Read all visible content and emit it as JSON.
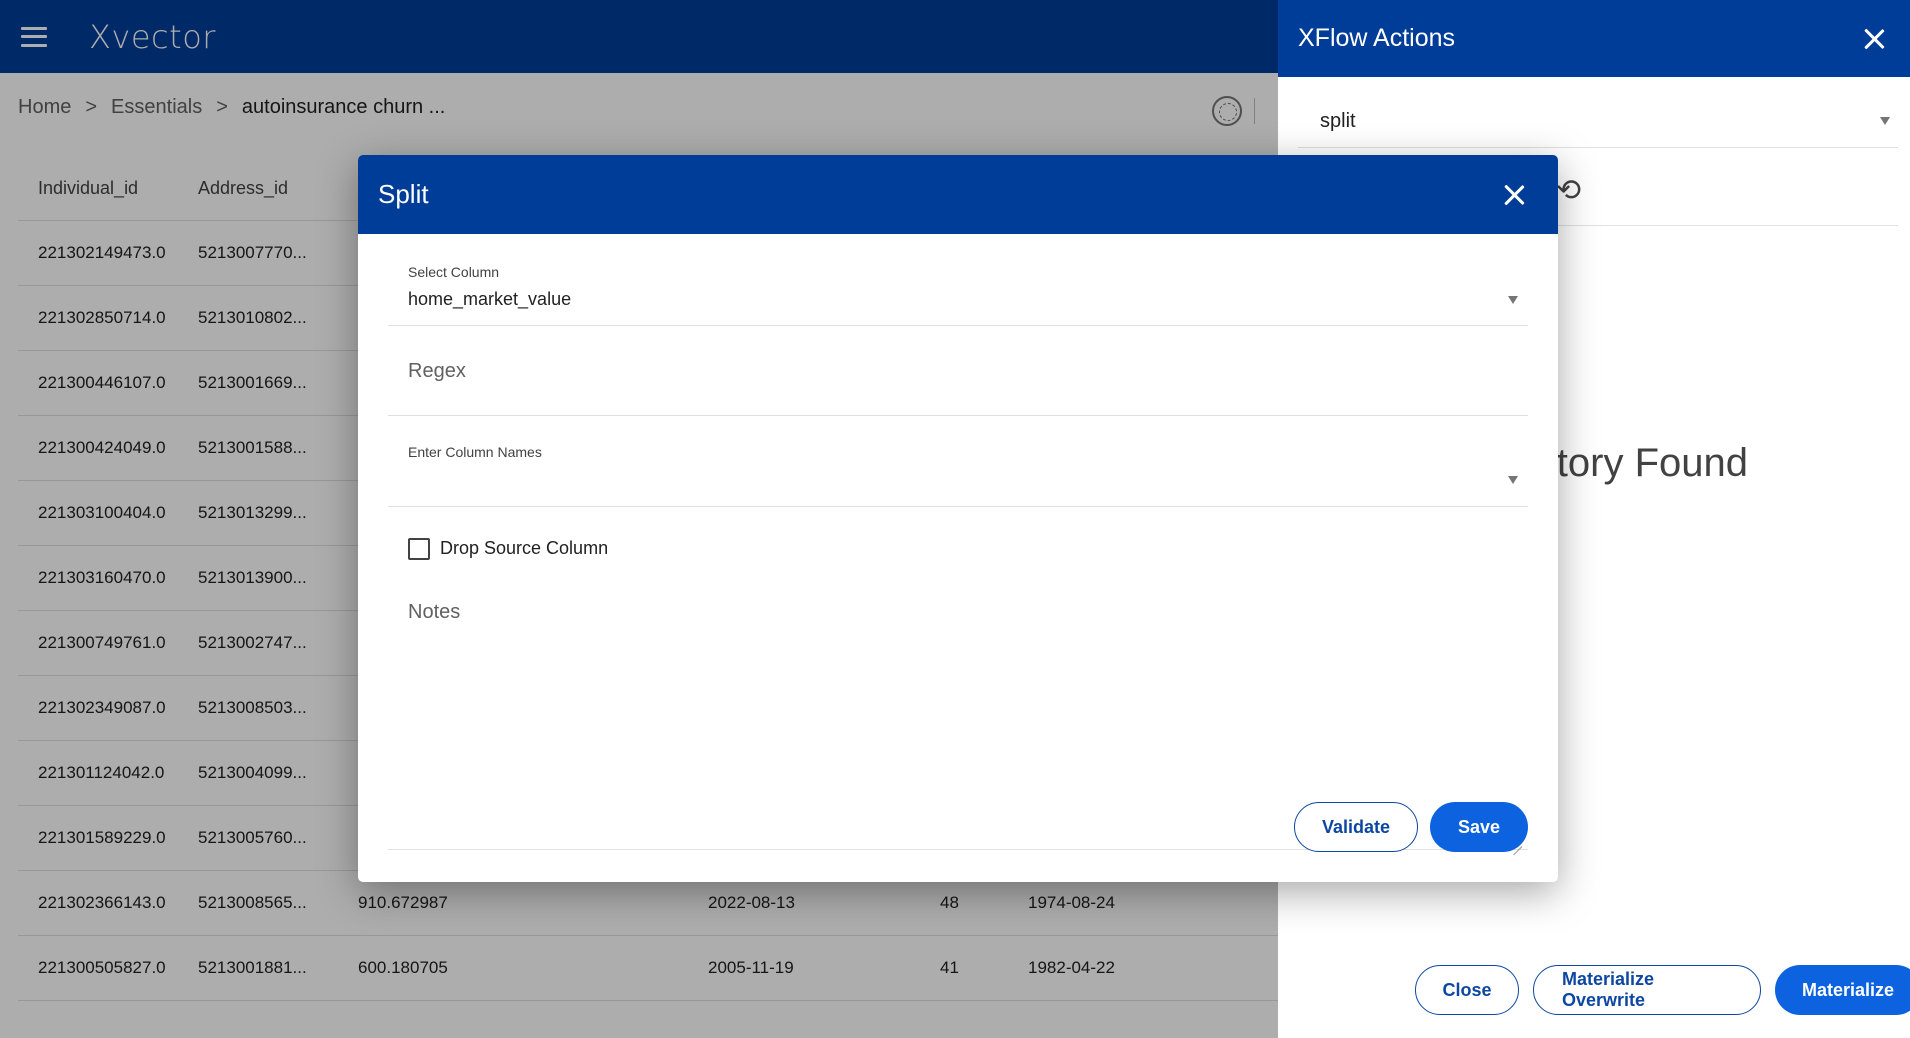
{
  "app": {
    "logo": "Xvector"
  },
  "breadcrumb": {
    "home": "Home",
    "sep": ">",
    "section": "Essentials",
    "current": "autoinsurance churn ..."
  },
  "table": {
    "headers": [
      "Individual_id",
      "Address_id"
    ],
    "rows": [
      [
        "221302149473.0",
        "5213007770..."
      ],
      [
        "221302850714.0",
        "5213010802..."
      ],
      [
        "221300446107.0",
        "5213001669..."
      ],
      [
        "221300424049.0",
        "5213001588..."
      ],
      [
        "221303100404.0",
        "5213013299..."
      ],
      [
        "221303160470.0",
        "5213013900..."
      ],
      [
        "221300749761.0",
        "5213002747..."
      ],
      [
        "221302349087.0",
        "5213008503..."
      ],
      [
        "221301124042.0",
        "5213004099..."
      ],
      [
        "221301589229.0",
        "5213005760..."
      ],
      [
        "221302366143.0",
        "5213008565...",
        "910.672987",
        "2022-08-13",
        "48",
        "1974-08-24"
      ],
      [
        "221300505827.0",
        "5213001881...",
        "600.180705",
        "2005-11-19",
        "41",
        "1982-04-22"
      ]
    ]
  },
  "drawer": {
    "title": "XFlow Actions",
    "selected_action": "split",
    "no_history": "story Found",
    "buttons": {
      "close": "Close",
      "materialize_overwrite": "Materialize Overwrite",
      "materialize": "Materialize"
    }
  },
  "modal": {
    "title": "Split",
    "select_column_label": "Select Column",
    "select_column_value": "home_market_value",
    "regex_placeholder": "Regex",
    "column_names_label": "Enter Column Names",
    "drop_source_label": "Drop Source Column",
    "notes_placeholder": "Notes",
    "buttons": {
      "validate": "Validate",
      "save": "Save"
    }
  },
  "colors": {
    "header_blue": "#003d99",
    "primary": "#0d62e0"
  },
  "icons": [
    "menu-icon",
    "globe-icon",
    "close-icon",
    "refresh-icon",
    "chevron-down-icon"
  ]
}
